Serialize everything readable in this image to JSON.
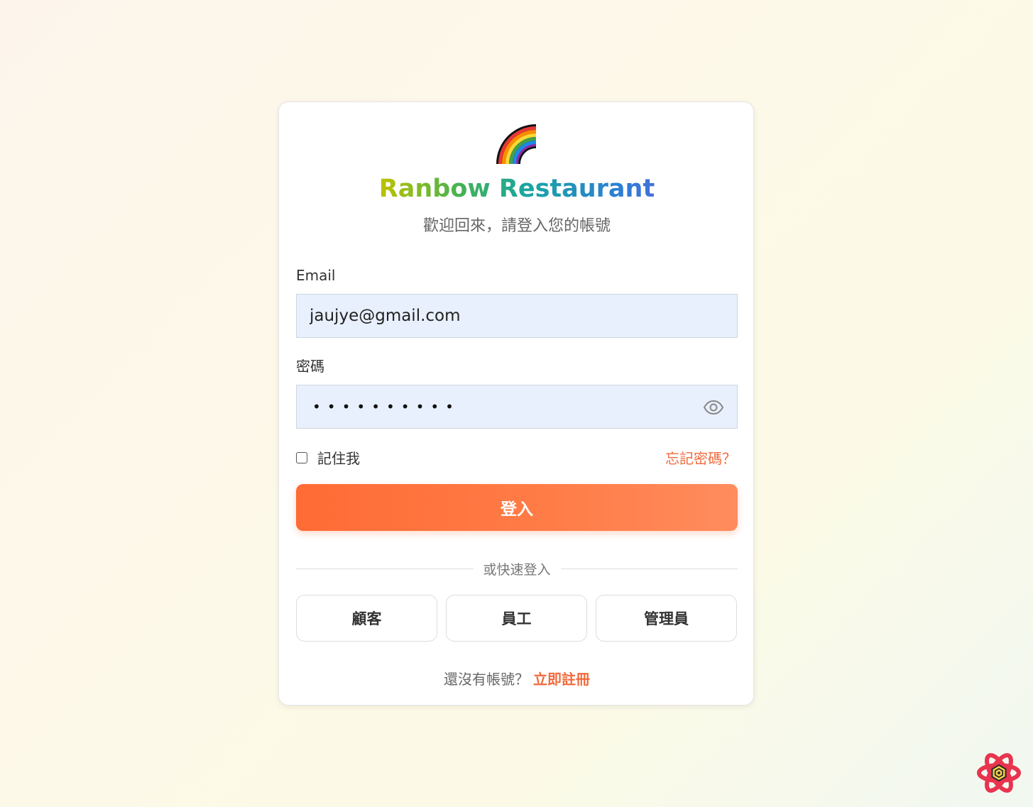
{
  "brand": {
    "logo_icon": "rainbow-icon",
    "title": "Ranbow Restaurant",
    "subtitle": "歡迎回來，請登入您的帳號"
  },
  "form": {
    "email_label": "Email",
    "email_value": "jaujye@gmail.com",
    "password_label": "密碼",
    "password_mask": "••••••••••",
    "password_toggle_icon": "eye-icon",
    "remember_label": "記住我",
    "remember_checked": false,
    "forgot_label": "忘記密碼？",
    "submit_label": "登入"
  },
  "quick_login": {
    "divider_text": "或快速登入",
    "options": [
      "顧客",
      "員工",
      "管理員"
    ]
  },
  "register": {
    "prompt": "還沒有帳號？",
    "link": "立即註冊"
  },
  "devtools": {
    "icon": "react-devtools-icon"
  },
  "colors": {
    "accent": "#ff6b35",
    "link": "#f26a3c",
    "input_bg": "#e8f0fd"
  }
}
